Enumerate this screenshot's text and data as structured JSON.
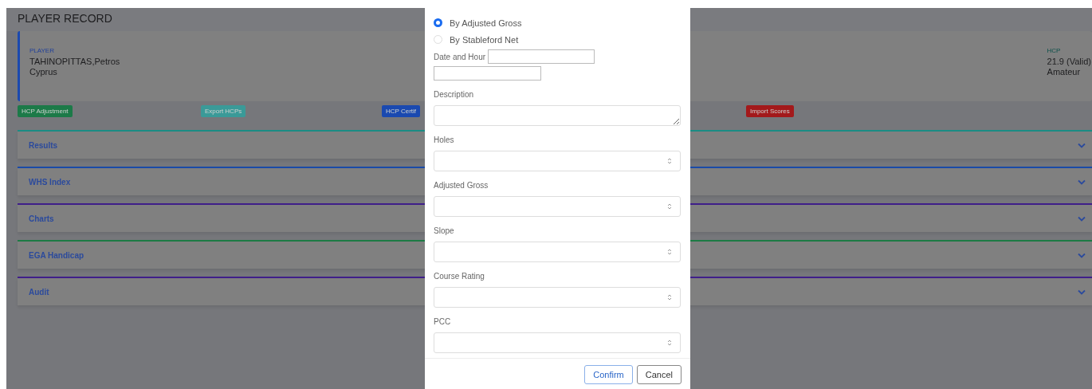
{
  "page": {
    "title": "PLAYER RECORD"
  },
  "player_card": {
    "player_label": "PLAYER",
    "name": "TAHINOPITTAS,Petros",
    "country": "Cyprus",
    "hcp_label": "HCP",
    "hcp_value": "21.9 (Valid)",
    "status": "Amateur"
  },
  "actions": [
    {
      "label": "HCP Adjustment",
      "color": "#1c7a48"
    },
    {
      "label": "Export HCPs",
      "color": "#3a9a98"
    },
    {
      "label": "HCP Certif",
      "color": "#1a49b0"
    },
    {
      "label": "Import Scores",
      "color": "#a3191b"
    }
  ],
  "sections": [
    {
      "title": "Results",
      "color": "#1b8c84",
      "expanded": false
    },
    {
      "title": "WHS Index",
      "color": "#1a4aa8",
      "expanded": false
    },
    {
      "title": "Charts",
      "color": "#3f1f8a",
      "expanded": false
    },
    {
      "title": "EGA Handicap",
      "color": "#1d7a44",
      "expanded": false
    },
    {
      "title": "Audit",
      "color": "#3f1f8a",
      "expanded": false
    }
  ],
  "modal": {
    "radios": [
      {
        "label": "By Adjusted Gross",
        "selected": true
      },
      {
        "label": "By Stableford Net",
        "selected": false
      }
    ],
    "date_label": "Date and Hour",
    "fields": [
      {
        "label": "Description",
        "kind": "textarea"
      },
      {
        "label": "Holes",
        "kind": "number"
      },
      {
        "label": "Adjusted Gross",
        "kind": "number"
      },
      {
        "label": "Slope",
        "kind": "number"
      },
      {
        "label": "Course Rating",
        "kind": "number"
      },
      {
        "label": "PCC",
        "kind": "number"
      }
    ],
    "buttons": [
      {
        "label": "Confirm",
        "kind": "primary"
      },
      {
        "label": "Cancel",
        "kind": "secondary"
      }
    ]
  }
}
